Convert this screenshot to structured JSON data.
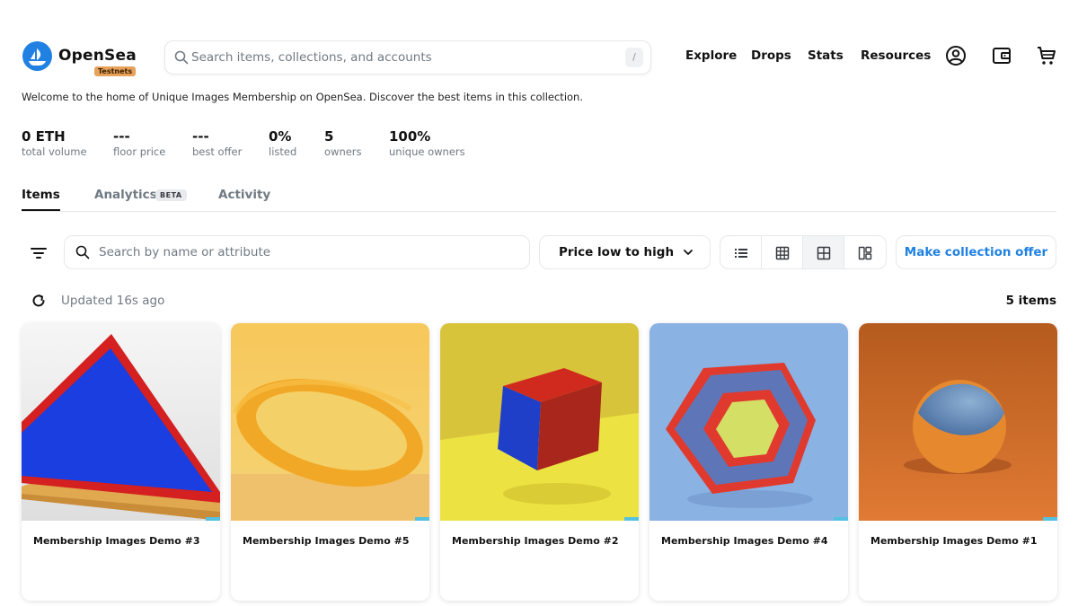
{
  "header": {
    "brand": "OpenSea",
    "badge": "Testnets",
    "search_placeholder": "Search items, collections, and accounts",
    "search_shortcut": "/",
    "nav": [
      "Explore",
      "Drops",
      "Stats",
      "Resources"
    ],
    "accent": "#2081e2"
  },
  "welcome": "Welcome to the home of Unique Images Membership on OpenSea. Discover the best items in this collection.",
  "stats": [
    {
      "value": "0 ETH",
      "label": "total volume"
    },
    {
      "value": "---",
      "label": "floor price"
    },
    {
      "value": "---",
      "label": "best offer"
    },
    {
      "value": "0%",
      "label": "listed"
    },
    {
      "value": "5",
      "label": "owners"
    },
    {
      "value": "100%",
      "label": "unique owners"
    }
  ],
  "tabs": {
    "items": "Items",
    "analytics": "Analytics",
    "analytics_badge": "BETA",
    "activity": "Activity"
  },
  "toolbar": {
    "attr_placeholder": "Search by name or attribute",
    "sort_label": "Price low to high",
    "offer_label": "Make collection offer",
    "view_icons": [
      "list-view-icon",
      "small-grid-icon",
      "large-grid-icon",
      "mosaic-view-icon"
    ],
    "selected_view": "large-grid-icon"
  },
  "status": {
    "updated": "Updated 16s ago",
    "count": "5 items"
  },
  "items": [
    {
      "name": "Membership Images Demo #3"
    },
    {
      "name": "Membership Images Demo #5"
    },
    {
      "name": "Membership Images Demo #2"
    },
    {
      "name": "Membership Images Demo #4"
    },
    {
      "name": "Membership Images Demo #1"
    }
  ]
}
